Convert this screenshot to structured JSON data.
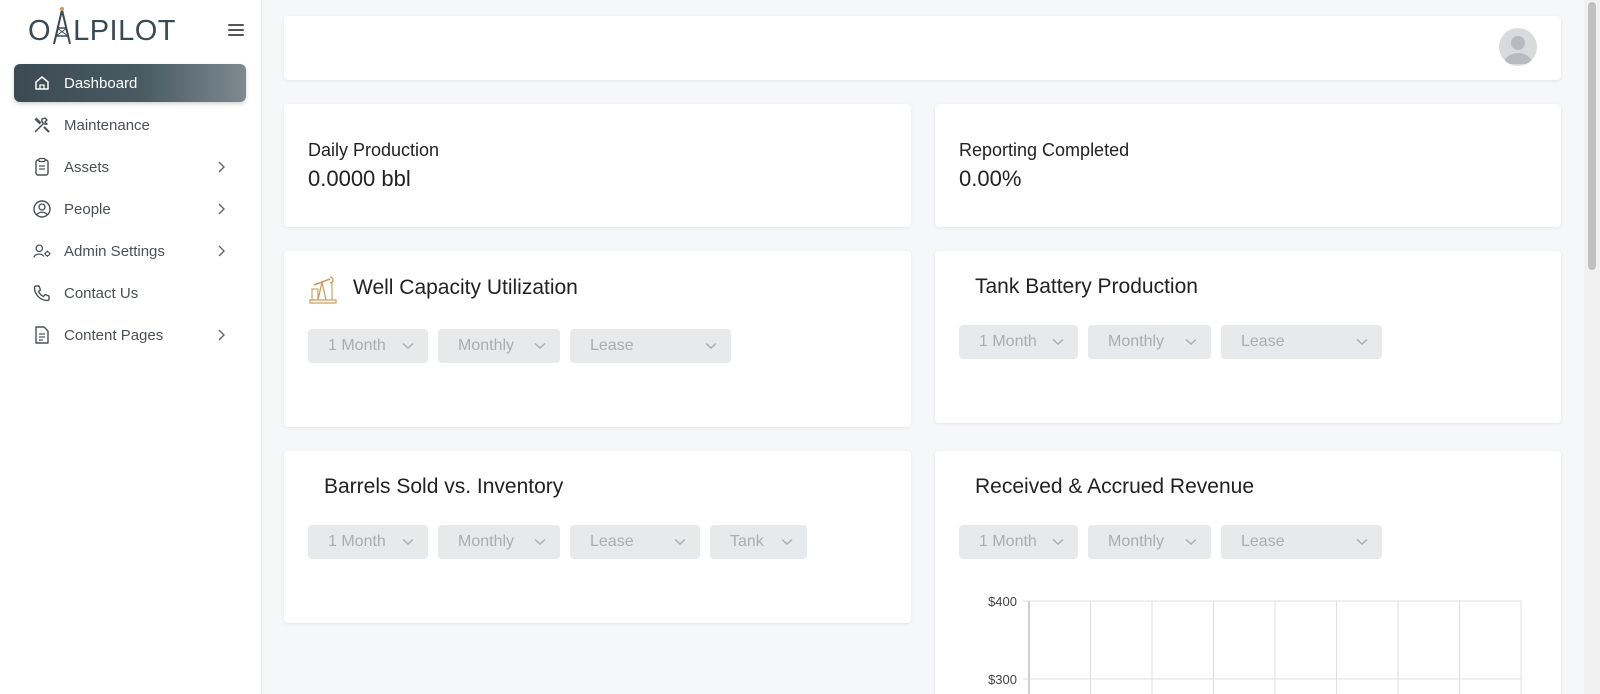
{
  "brand": {
    "logo_text_before": "O",
    "logo_text_after": "LPILOT"
  },
  "sidebar": {
    "items": [
      {
        "label": "Dashboard",
        "icon": "home-icon",
        "has_children": false,
        "active": true
      },
      {
        "label": "Maintenance",
        "icon": "tools-icon",
        "has_children": false
      },
      {
        "label": "Assets",
        "icon": "clipboard-icon",
        "has_children": true
      },
      {
        "label": "People",
        "icon": "user-circle-icon",
        "has_children": true
      },
      {
        "label": "Admin Settings",
        "icon": "user-settings-icon",
        "has_children": true
      },
      {
        "label": "Contact Us",
        "icon": "phone-icon",
        "has_children": false
      },
      {
        "label": "Content Pages",
        "icon": "document-icon",
        "has_children": true
      }
    ]
  },
  "stats": {
    "daily_production": {
      "label": "Daily Production",
      "value": "0.0000 bbl"
    },
    "reporting_completed": {
      "label": "Reporting Completed",
      "value": "0.00%"
    }
  },
  "cards": {
    "well_capacity": {
      "title": "Well Capacity Utilization",
      "filters": [
        "1 Month",
        "Monthly",
        "Lease"
      ]
    },
    "tank_battery": {
      "title": "Tank Battery Production",
      "filters": [
        "1 Month",
        "Monthly",
        "Lease"
      ]
    },
    "barrels_sold": {
      "title": "Barrels Sold vs. Inventory",
      "filters": [
        "1 Month",
        "Monthly",
        "Lease",
        "Tank"
      ]
    },
    "revenue": {
      "title": "Received & Accrued Revenue",
      "filters": [
        "1 Month",
        "Monthly",
        "Lease"
      ]
    }
  },
  "chart_data": {
    "type": "bar",
    "title": "Received & Accrued Revenue",
    "y_ticks": [
      "$400",
      "$300"
    ],
    "ylim": [
      300,
      400
    ],
    "grid": true,
    "series": []
  },
  "colors": {
    "accent_gradient_start": "#3b4a53",
    "accent_gradient_end": "#7d8a90",
    "filter_bg": "#e8e9eb",
    "filter_text": "#a9adb1"
  }
}
